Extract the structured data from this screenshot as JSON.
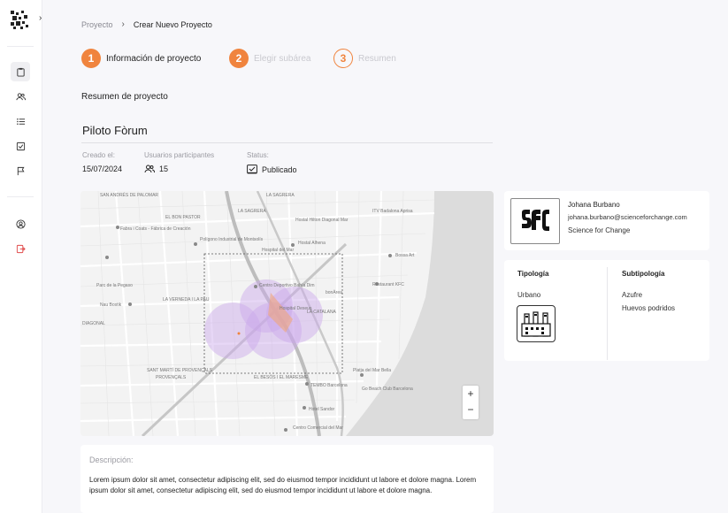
{
  "breadcrumb": {
    "root": "Proyecto",
    "separator": "›",
    "current": "Crear Nuevo Proyecto"
  },
  "steps": [
    {
      "number": "1",
      "label": "Información de proyecto",
      "state": "active"
    },
    {
      "number": "2",
      "label": "Elegir subárea",
      "state": "inactive"
    },
    {
      "number": "3",
      "label": "Resumen",
      "state": "inactive"
    }
  ],
  "summary": {
    "section_title": "Resumen de proyecto",
    "project_name": "Piloto Fòrum",
    "created_label": "Creado el:",
    "created_value": "15/07/2024",
    "users_label": "Usuarios participantes",
    "users_value": "15",
    "status_label": "Status:",
    "status_value": "Publicado"
  },
  "map": {
    "labels": [
      "SAN ANDRÉS DE PALOMAR",
      "EL BON PASTOR",
      "Fabra i Coats - Fábrica de Creación",
      "LA SAGRERA",
      "Polígono Industrial de Montsolís",
      "LA VERNEDA I LA PAU",
      "Nau Bostik",
      "Parc de la Pegaso",
      "SANT MARTÍ DE PROVENÇALS",
      "Hospital del Mar",
      "Hostal Alhena",
      "Bossa Art",
      "Centro Deportivo Bahía Dim",
      "Restaurant KFC",
      "Hospital Dexeus",
      "LA CATALANA",
      "bonÀrea",
      "Platja del Mar Bella",
      "TEMBO Barcelona",
      "Go Beach Club Barcelona",
      "EL BESÒS I EL MARESME",
      "Hotel Sandor",
      "ITV Badalona Aprisa",
      "Hostal Hilton Diagonal Mar",
      "Centro Comercial del Mar",
      "LA SAGRERA",
      "PROVENÇALS",
      "DIAGONAL"
    ],
    "zoom_in": "+",
    "zoom_out": "−",
    "colors": {
      "accent": "#f0843e",
      "zone": "#c9a6ea"
    }
  },
  "description": {
    "label": "Descripción:",
    "text": "Lorem ipsum dolor sit amet, consectetur adipiscing elit, sed do eiusmod tempor incididunt ut labore et dolore magna. Lorem ipsum dolor sit amet, consectetur adipiscing elit, sed do eiusmod tempor incididunt ut labore et dolore magna."
  },
  "organization": {
    "logo_text": "SfC",
    "name": "Johana Burbano",
    "email": "johana.burbano@scienceforchange.com",
    "company": "Science for Change"
  },
  "typology": {
    "type_header": "Tipología",
    "type_value": "Urbano",
    "type_icon": "factory-icon",
    "subtype_header": "Subtipología",
    "subtypes": [
      "Azufre",
      "Huevos podridos"
    ]
  }
}
